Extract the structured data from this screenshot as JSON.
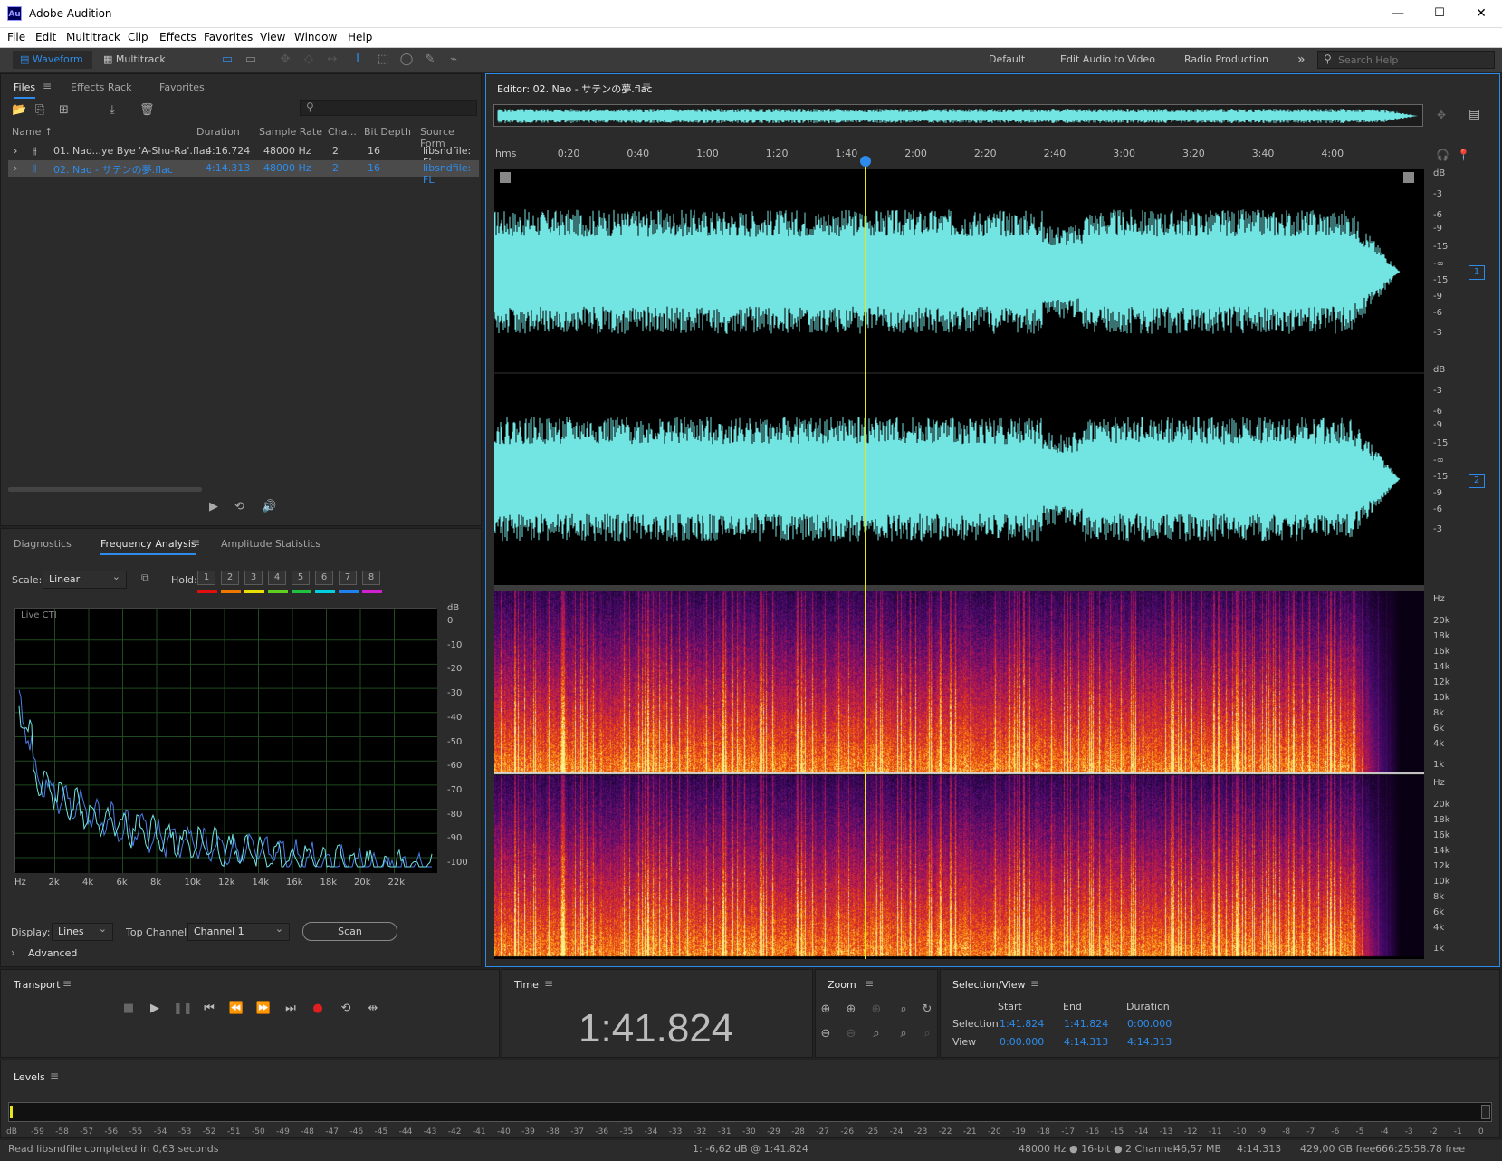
{
  "app": {
    "logo": "Au",
    "title": "Adobe Audition"
  },
  "menu": [
    "File",
    "Edit",
    "Multitrack",
    "Clip",
    "Effects",
    "Favorites",
    "View",
    "Window",
    "Help"
  ],
  "toolbar": {
    "waveform": "Waveform",
    "multitrack": "Multitrack",
    "workspaces": [
      "Default",
      "Edit Audio to Video",
      "Radio Production"
    ],
    "more": "»",
    "search_placeholder": "Search Help"
  },
  "files_panel": {
    "tabs": [
      "Files",
      "Effects Rack",
      "Favorites"
    ],
    "columns": [
      "Name ↑",
      "Duration",
      "Sample Rate",
      "Cha...",
      "Bit Depth",
      "Source Form"
    ],
    "rows": [
      {
        "name": "01. Nao...ye Bye 'A-Shu-Ra'.flac",
        "duration": "4:16.724",
        "rate": "48000 Hz",
        "ch": "2",
        "bits": "16",
        "src": "libsndfile: FL",
        "selected": false
      },
      {
        "name": "02. Nao - サテンの夢.flac",
        "duration": "4:14.313",
        "rate": "48000 Hz",
        "ch": "2",
        "bits": "16",
        "src": "libsndfile: FL",
        "selected": true
      }
    ]
  },
  "analysis_panel": {
    "tabs": [
      "Diagnostics",
      "Frequency Analysis",
      "Amplitude Statistics"
    ],
    "scale_label": "Scale:",
    "scale_value": "Linear",
    "hold_label": "Hold:",
    "hold_buttons": [
      "1",
      "2",
      "3",
      "4",
      "5",
      "6",
      "7",
      "8"
    ],
    "hold_colors": [
      "#e01010",
      "#f07800",
      "#e8e000",
      "#60d020",
      "#20c040",
      "#00d0e0",
      "#2080f0",
      "#d020d0"
    ],
    "graph_label": "Live CTI",
    "db_labels": [
      "dB",
      "0",
      "-10",
      "-20",
      "-30",
      "-40",
      "-50",
      "-60",
      "-70",
      "-80",
      "-90",
      "-100"
    ],
    "hz_labels": [
      "Hz",
      "2k",
      "4k",
      "6k",
      "8k",
      "10k",
      "12k",
      "14k",
      "16k",
      "18k",
      "20k",
      "22k"
    ],
    "display_label": "Display:",
    "display_value": "Lines",
    "top_channel_label": "Top Channel:",
    "top_channel_value": "Channel 1",
    "scan_label": "Scan",
    "advanced_label": "Advanced"
  },
  "editor": {
    "title": "Editor: 02. Nao - サテンの夢.flac",
    "ruler": [
      "hms",
      "0:20",
      "0:40",
      "1:00",
      "1:20",
      "1:40",
      "2:00",
      "2:20",
      "2:40",
      "3:00",
      "3:20",
      "3:40",
      "4:00"
    ],
    "db_scale": [
      "dB",
      "-3",
      "-6",
      "-9",
      "-15",
      "-∞",
      "-15",
      "-9",
      "-6",
      "-3"
    ],
    "hz_scale": [
      "Hz",
      "20k",
      "18k",
      "16k",
      "14k",
      "12k",
      "10k",
      "8k",
      "6k",
      "4k",
      "1k"
    ],
    "channels": [
      "1",
      "2"
    ],
    "waveform_color": "#72e4e2"
  },
  "transport": {
    "title": "Transport"
  },
  "time": {
    "title": "Time",
    "value": "1:41.824"
  },
  "zoom": {
    "title": "Zoom"
  },
  "selection": {
    "title": "Selection/View",
    "headers": [
      "Start",
      "End",
      "Duration"
    ],
    "rows": [
      {
        "label": "Selection",
        "start": "1:41.824",
        "end": "1:41.824",
        "duration": "0:00.000"
      },
      {
        "label": "View",
        "start": "0:00.000",
        "end": "4:14.313",
        "duration": "4:14.313"
      }
    ]
  },
  "levels": {
    "title": "Levels",
    "ticks": [
      "dB",
      "-59",
      "-58",
      "-57",
      "-56",
      "-55",
      "-54",
      "-53",
      "-52",
      "-51",
      "-50",
      "-49",
      "-48",
      "-47",
      "-46",
      "-45",
      "-44",
      "-43",
      "-42",
      "-41",
      "-40",
      "-39",
      "-38",
      "-37",
      "-36",
      "-35",
      "-34",
      "-33",
      "-32",
      "-31",
      "-30",
      "-29",
      "-28",
      "-27",
      "-26",
      "-25",
      "-24",
      "-23",
      "-22",
      "-21",
      "-20",
      "-19",
      "-18",
      "-17",
      "-16",
      "-15",
      "-14",
      "-13",
      "-12",
      "-11",
      "-10",
      "-9",
      "-8",
      "-7",
      "-6",
      "-5",
      "-4",
      "-3",
      "-2",
      "-1",
      "0"
    ]
  },
  "status": {
    "message": "Read libsndfile completed in 0,63 seconds",
    "cursor": "1: -6,62 dB @ 1:41.824",
    "format": "48000 Hz ● 16-bit ● 2 Channel",
    "size": "46,57 MB",
    "duration": "4:14.313",
    "free": "429,00 GB free",
    "free_time": "666:25:58.78 free"
  }
}
